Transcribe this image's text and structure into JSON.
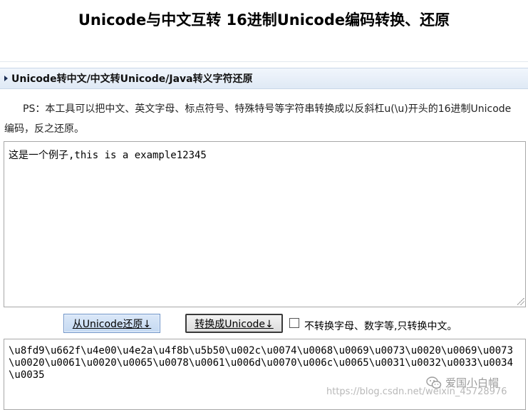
{
  "page": {
    "title": "Unicode与中文互转 16进制Unicode编码转换、还原"
  },
  "section": {
    "title": "Unicode转中文/中文转Unicode/Java转义字符还原"
  },
  "description": "PS：本工具可以把中文、英文字母、标点符号、特殊特号等字符串转换成以反斜杠u(\\u)开头的16进制Unicode编码，反之还原。",
  "input": {
    "value": "这是一个例子,this is a example12345"
  },
  "buttons": {
    "restore_label": "从Unicode还原↓",
    "convert_label": "转换成Unicode↓"
  },
  "option": {
    "checkbox_label": "不转换字母、数字等,只转换中文。",
    "checked": false
  },
  "output": {
    "value": "\\u8fd9\\u662f\\u4e00\\u4e2a\\u4f8b\\u5b50\\u002c\\u0074\\u0068\\u0069\\u0073\\u0020\\u0069\\u0073\\u0020\\u0061\\u0020\\u0065\\u0078\\u0061\\u006d\\u0070\\u006c\\u0065\\u0031\\u0032\\u0033\\u0034\\u0035"
  },
  "watermark": {
    "brand": "爱国小白帽",
    "url": "https://blog.csdn.net/weixin_45728976",
    "icon": "wechat-icon"
  }
}
